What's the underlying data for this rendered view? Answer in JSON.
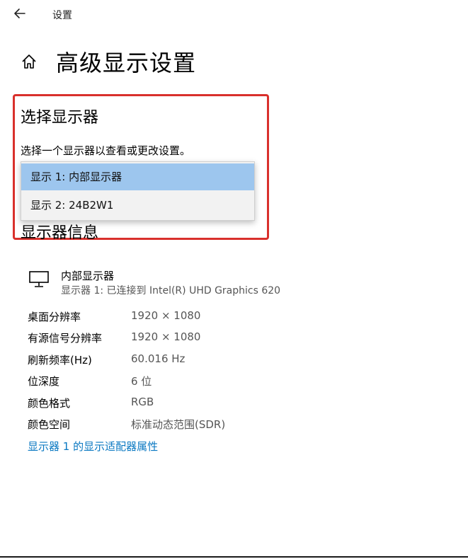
{
  "header": {
    "title": "设置"
  },
  "page": {
    "title": "高级显示设置"
  },
  "select_section": {
    "title": "选择显示器",
    "description": "选择一个显示器以查看或更改设置。",
    "options": [
      {
        "label": "显示 1: 内部显示器",
        "selected": true
      },
      {
        "label": "显示 2: 24B2W1",
        "selected": false
      }
    ]
  },
  "info_section": {
    "title": "显示器信息",
    "display_name": "内部显示器",
    "display_subtitle": "显示器 1: 已连接到 Intel(R) UHD Graphics 620",
    "rows": [
      {
        "label": "桌面分辨率",
        "value": "1920 × 1080"
      },
      {
        "label": "有源信号分辨率",
        "value": "1920 × 1080"
      },
      {
        "label": "刷新频率(Hz)",
        "value": "60.016 Hz"
      },
      {
        "label": "位深度",
        "value": "6 位"
      },
      {
        "label": "颜色格式",
        "value": "RGB"
      },
      {
        "label": "颜色空间",
        "value": "标准动态范围(SDR)"
      }
    ],
    "adapter_link": "显示器 1 的显示适配器属性"
  },
  "colors": {
    "accent_link": "#0a78c2",
    "selection": "#9dc6ee",
    "highlight_border": "#d9302c"
  }
}
